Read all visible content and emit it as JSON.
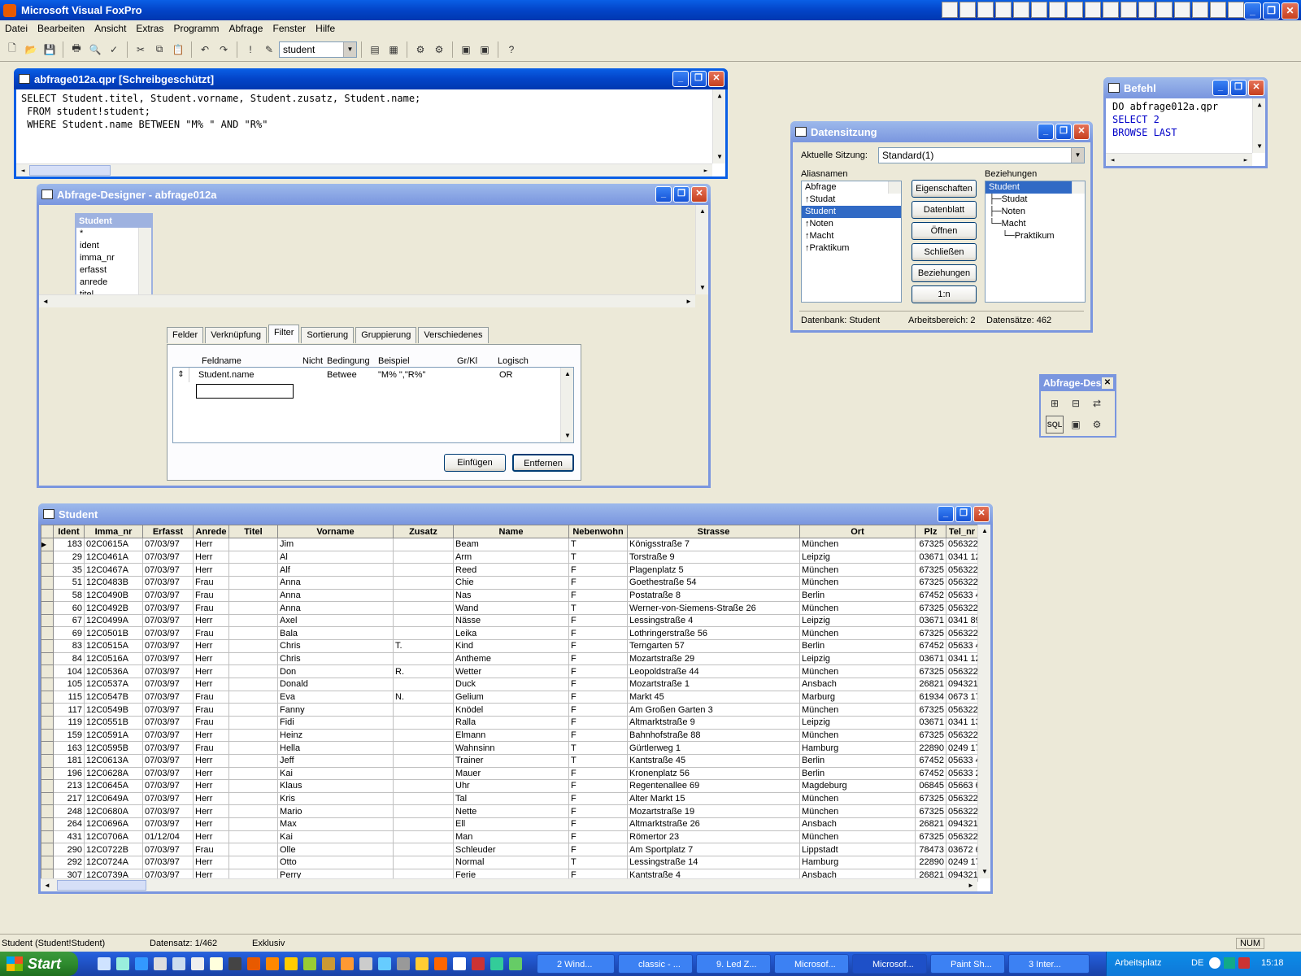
{
  "app": {
    "title": "Microsoft Visual FoxPro"
  },
  "menu": [
    "Datei",
    "Bearbeiten",
    "Ansicht",
    "Extras",
    "Programm",
    "Abfrage",
    "Fenster",
    "Hilfe"
  ],
  "toolbar": {
    "combo_value": "student"
  },
  "sqlwin": {
    "title": "abfrage012a.qpr [Schreibgeschützt]",
    "lines": [
      "SELECT Student.titel, Student.vorname, Student.zusatz, Student.name;",
      " FROM student!student;",
      " WHERE Student.name BETWEEN \"M% \" AND \"R%\""
    ]
  },
  "befehl": {
    "title": "Befehl",
    "lines": [
      "DO abfrage012a.qpr",
      "SELECT 2",
      "BROWSE LAST"
    ]
  },
  "designer": {
    "title": "Abfrage-Designer - abfrage012a",
    "table_title": "Student",
    "fields": [
      "*",
      "ident",
      "imma_nr",
      "erfasst",
      "anrede",
      "titel"
    ],
    "tabs": [
      "Felder",
      "Verknüpfung",
      "Filter",
      "Sortierung",
      "Gruppierung",
      "Verschiedenes"
    ],
    "active_tab": "Filter",
    "filter_headers": {
      "feldname": "Feldname",
      "nicht": "Nicht",
      "bedingung": "Bedingung",
      "beispiel": "Beispiel",
      "grkl": "Gr/Kl",
      "logisch": "Logisch"
    },
    "filter_row": {
      "feldname": "Student.name",
      "bedingung": "Betwee",
      "beispiel": "\"M% \",\"R%\"",
      "logisch": "OR"
    },
    "insert_label": "Einfügen",
    "remove_label": "Entfernen"
  },
  "datasession": {
    "title": "Datensitzung",
    "session_label": "Aktuelle Sitzung:",
    "session_value": "Standard(1)",
    "aliases_label": "Aliasnamen",
    "aliases": [
      "Abfrage",
      "↑Studat",
      "Student",
      "↑Noten",
      "↑Macht",
      "↑Praktikum"
    ],
    "relations_label": "Beziehungen",
    "relations": [
      "Student",
      "├─Studat",
      "├─Noten",
      "└─Macht",
      "  └─Praktikum"
    ],
    "buttons": [
      "Eigenschaften",
      "Datenblatt",
      "Öffnen",
      "Schließen",
      "Beziehungen",
      "1:n"
    ],
    "status": {
      "db": "Datenbank: Student",
      "area": "Arbeitsbereich: 2",
      "records": "Datensätze: 462"
    }
  },
  "qtool": {
    "title": "Abfrage-Des"
  },
  "browse": {
    "title": "Student",
    "columns": [
      "Ident",
      "Imma_nr",
      "Erfasst",
      "Anrede",
      "Titel",
      "Vorname",
      "Zusatz",
      "Name",
      "Nebenwohn",
      "Strasse",
      "Ort",
      "Plz",
      "Tel_nr"
    ],
    "rows": [
      [
        "183",
        "02C0615A",
        "07/03/97",
        "Herr",
        "",
        "Jim",
        "",
        "Beam",
        "T",
        "Königsstraße 7",
        "München",
        "67325",
        "056322"
      ],
      [
        "29",
        "12C0461A",
        "07/03/97",
        "Herr",
        "",
        "Al",
        "",
        "Arm",
        "T",
        "Torstraße 9",
        "Leipzig",
        "03671",
        "0341 12"
      ],
      [
        "35",
        "12C0467A",
        "07/03/97",
        "Herr",
        "",
        "Alf",
        "",
        "Reed",
        "F",
        "Plagenplatz 5",
        "München",
        "67325",
        "056322"
      ],
      [
        "51",
        "12C0483B",
        "07/03/97",
        "Frau",
        "",
        "Anna",
        "",
        "Chie",
        "F",
        "Goethestraße 54",
        "München",
        "67325",
        "056322"
      ],
      [
        "58",
        "12C0490B",
        "07/03/97",
        "Frau",
        "",
        "Anna",
        "",
        "Nas",
        "F",
        "Postatraße 8",
        "Berlin",
        "67452",
        "05633 4"
      ],
      [
        "60",
        "12C0492B",
        "07/03/97",
        "Frau",
        "",
        "Anna",
        "",
        "Wand",
        "T",
        "Werner-von-Siemens-Straße 26",
        "München",
        "67325",
        "056322"
      ],
      [
        "67",
        "12C0499A",
        "07/03/97",
        "Herr",
        "",
        "Axel",
        "",
        "Nässe",
        "F",
        "Lessingstraße 4",
        "Leipzig",
        "03671",
        "0341 89"
      ],
      [
        "69",
        "12C0501B",
        "07/03/97",
        "Frau",
        "",
        "Bala",
        "",
        "Leika",
        "F",
        "Lothringerstraße 56",
        "München",
        "67325",
        "056322"
      ],
      [
        "83",
        "12C0515A",
        "07/03/97",
        "Herr",
        "",
        "Chris",
        "T.",
        "Kind",
        "F",
        "Terngarten 57",
        "Berlin",
        "67452",
        "05633 4"
      ],
      [
        "84",
        "12C0516A",
        "07/03/97",
        "Herr",
        "",
        "Chris",
        "",
        "Antheme",
        "F",
        "Mozartstraße 29",
        "Leipzig",
        "03671",
        "0341 12"
      ],
      [
        "104",
        "12C0536A",
        "07/03/97",
        "Herr",
        "",
        "Don",
        "R.",
        "Wetter",
        "F",
        "Leopoldstraße 44",
        "München",
        "67325",
        "056322"
      ],
      [
        "105",
        "12C0537A",
        "07/03/97",
        "Herr",
        "",
        "Donald",
        "",
        "Duck",
        "F",
        "Mozartstraße 1",
        "Ansbach",
        "26821",
        "094321"
      ],
      [
        "115",
        "12C0547B",
        "07/03/97",
        "Frau",
        "",
        "Eva",
        "N.",
        "Gelium",
        "F",
        "Markt 45",
        "Marburg",
        "61934",
        "0673 17"
      ],
      [
        "117",
        "12C0549B",
        "07/03/97",
        "Frau",
        "",
        "Fanny",
        "",
        "Knödel",
        "F",
        "Am Großen Garten 3",
        "München",
        "67325",
        "056322"
      ],
      [
        "119",
        "12C0551B",
        "07/03/97",
        "Frau",
        "",
        "Fidi",
        "",
        "Ralla",
        "F",
        "Altmarktstraße 9",
        "Leipzig",
        "03671",
        "0341 13"
      ],
      [
        "159",
        "12C0591A",
        "07/03/97",
        "Herr",
        "",
        "Heinz",
        "",
        "Elmann",
        "F",
        "Bahnhofstraße 88",
        "München",
        "67325",
        "056322"
      ],
      [
        "163",
        "12C0595B",
        "07/03/97",
        "Frau",
        "",
        "Hella",
        "",
        "Wahnsinn",
        "T",
        "Gürtlerweg 1",
        "Hamburg",
        "22890",
        "0249 17"
      ],
      [
        "181",
        "12C0613A",
        "07/03/97",
        "Herr",
        "",
        "Jeff",
        "",
        "Trainer",
        "T",
        "Kantstraße 45",
        "Berlin",
        "67452",
        "05633 4"
      ],
      [
        "196",
        "12C0628A",
        "07/03/97",
        "Herr",
        "",
        "Kai",
        "",
        "Mauer",
        "F",
        "Kronenplatz 56",
        "Berlin",
        "67452",
        "05633 2"
      ],
      [
        "213",
        "12C0645A",
        "07/03/97",
        "Herr",
        "",
        "Klaus",
        "",
        "Uhr",
        "F",
        "Regentenallee 69",
        "Magdeburg",
        "06845",
        "05663 6"
      ],
      [
        "217",
        "12C0649A",
        "07/03/97",
        "Herr",
        "",
        "Kris",
        "",
        "Tal",
        "F",
        "Alter Markt 15",
        "München",
        "67325",
        "056322"
      ],
      [
        "248",
        "12C0680A",
        "07/03/97",
        "Herr",
        "",
        "Mario",
        "",
        "Nette",
        "F",
        "Mozartstraße 19",
        "München",
        "67325",
        "056322"
      ],
      [
        "264",
        "12C0696A",
        "07/03/97",
        "Herr",
        "",
        "Max",
        "",
        "Ell",
        "F",
        "Altmarktstraße 26",
        "Ansbach",
        "26821",
        "094321"
      ],
      [
        "431",
        "12C0706A",
        "01/12/04",
        "Herr",
        "",
        "Kai",
        "",
        "Man",
        "F",
        "Römertor 23",
        "München",
        "67325",
        "056322"
      ],
      [
        "290",
        "12C0722B",
        "07/03/97",
        "Frau",
        "",
        "Olle",
        "",
        "Schleuder",
        "F",
        "Am Sportplatz 7",
        "Lippstadt",
        "78473",
        "03672 6"
      ],
      [
        "292",
        "12C0724A",
        "07/03/97",
        "Herr",
        "",
        "Otto",
        "",
        "Normal",
        "T",
        "Lessingstraße 14",
        "Hamburg",
        "22890",
        "0249 17"
      ],
      [
        "307",
        "12C0739A",
        "07/03/97",
        "Herr",
        "",
        "Perry",
        "",
        "Ferie",
        "F",
        "Kantstraße 4",
        "Ansbach",
        "26821",
        "094321"
      ]
    ]
  },
  "statusbar": {
    "alias": "Student (Student!Student)",
    "record": "Datensatz: 1/462",
    "mode": "Exklusiv",
    "num": "NUM"
  },
  "taskbar": {
    "start": "Start",
    "tasks": [
      "2 Wind...",
      "classic - ...",
      "9. Led Z...",
      "Microsof...",
      "Microsof...",
      "Paint Sh...",
      "3 Inter..."
    ],
    "tray_label": "Arbeitsplatz",
    "lang": "DE",
    "time": "15:18"
  }
}
